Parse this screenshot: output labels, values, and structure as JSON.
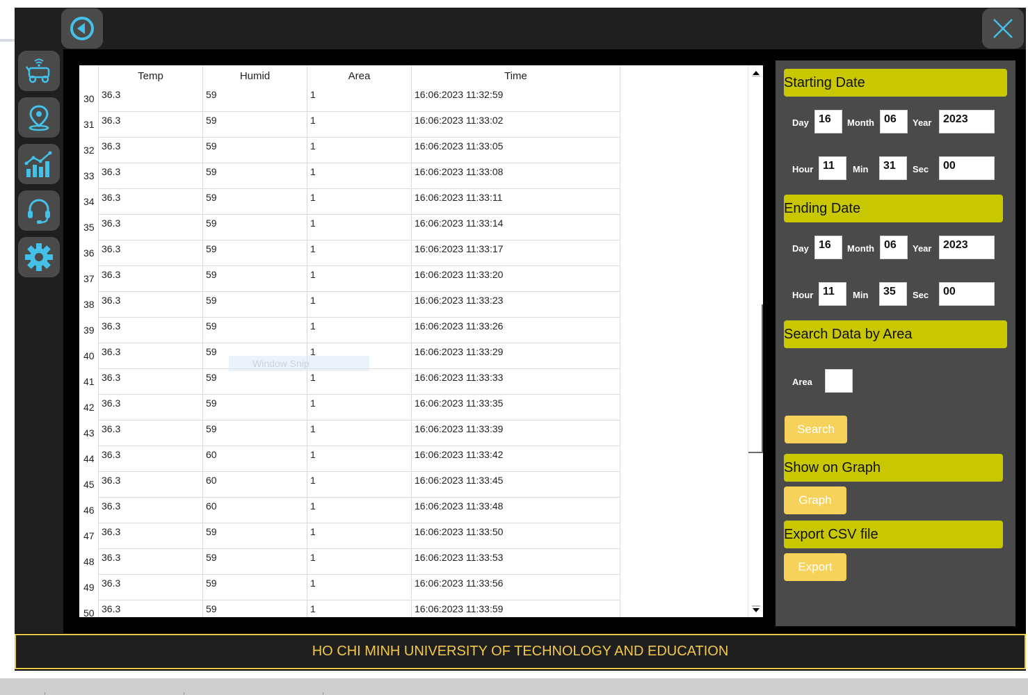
{
  "icons": {
    "back": "back-arrow-icon",
    "close": "close-x-icon",
    "sidebar": [
      "robot-car-icon",
      "location-pin-icon",
      "bar-chart-icon",
      "headset-icon",
      "gear-icon"
    ],
    "accent_color": "#44c1e8"
  },
  "table": {
    "headers": [
      "Temp",
      "Humid",
      "Area",
      "Time"
    ],
    "rows": [
      {
        "n": "30",
        "temp": "36.3",
        "humid": "59",
        "area": "1",
        "time": "16:06:2023 11:32:59"
      },
      {
        "n": "31",
        "temp": "36.3",
        "humid": "59",
        "area": "1",
        "time": "16:06:2023 11:33:02"
      },
      {
        "n": "32",
        "temp": "36.3",
        "humid": "59",
        "area": "1",
        "time": "16:06:2023 11:33:05"
      },
      {
        "n": "33",
        "temp": "36.3",
        "humid": "59",
        "area": "1",
        "time": "16:06:2023 11:33:08"
      },
      {
        "n": "34",
        "temp": "36.3",
        "humid": "59",
        "area": "1",
        "time": "16:06:2023 11:33:11"
      },
      {
        "n": "35",
        "temp": "36.3",
        "humid": "59",
        "area": "1",
        "time": "16:06:2023 11:33:14"
      },
      {
        "n": "36",
        "temp": "36.3",
        "humid": "59",
        "area": "1",
        "time": "16:06:2023 11:33:17"
      },
      {
        "n": "37",
        "temp": "36.3",
        "humid": "59",
        "area": "1",
        "time": "16:06:2023 11:33:20"
      },
      {
        "n": "38",
        "temp": "36.3",
        "humid": "59",
        "area": "1",
        "time": "16:06:2023 11:33:23"
      },
      {
        "n": "39",
        "temp": "36.3",
        "humid": "59",
        "area": "1",
        "time": "16:06:2023 11:33:26"
      },
      {
        "n": "40",
        "temp": "36.3",
        "humid": "59",
        "area": "1",
        "time": "16:06:2023 11:33:29"
      },
      {
        "n": "41",
        "temp": "36.3",
        "humid": "59",
        "area": "1",
        "time": "16:06:2023 11:33:33"
      },
      {
        "n": "42",
        "temp": "36.3",
        "humid": "59",
        "area": "1",
        "time": "16:06:2023 11:33:35"
      },
      {
        "n": "43",
        "temp": "36.3",
        "humid": "59",
        "area": "1",
        "time": "16:06:2023 11:33:39"
      },
      {
        "n": "44",
        "temp": "36.3",
        "humid": "60",
        "area": "1",
        "time": "16:06:2023 11:33:42"
      },
      {
        "n": "45",
        "temp": "36.3",
        "humid": "60",
        "area": "1",
        "time": "16:06:2023 11:33:45"
      },
      {
        "n": "46",
        "temp": "36.3",
        "humid": "60",
        "area": "1",
        "time": "16:06:2023 11:33:48"
      },
      {
        "n": "47",
        "temp": "36.3",
        "humid": "59",
        "area": "1",
        "time": "16:06:2023 11:33:50"
      },
      {
        "n": "48",
        "temp": "36.3",
        "humid": "59",
        "area": "1",
        "time": "16:06:2023 11:33:53"
      },
      {
        "n": "49",
        "temp": "36.3",
        "humid": "59",
        "area": "1",
        "time": "16:06:2023 11:33:56"
      },
      {
        "n": "50",
        "temp": "36.3",
        "humid": "59",
        "area": "1",
        "time": "16:06:2023 11:33:59"
      }
    ]
  },
  "overlay": {
    "snip_text": "Window Snip"
  },
  "panel": {
    "starting_title": "Starting Date",
    "ending_title": "Ending Date",
    "labels": {
      "day": "Day",
      "month": "Month",
      "year": "Year",
      "hour": "Hour",
      "min": "Min",
      "sec": "Sec",
      "area": "Area"
    },
    "start": {
      "day": "16",
      "month": "06",
      "year": "2023",
      "hour": "11",
      "min": "31",
      "sec": "00"
    },
    "end": {
      "day": "16",
      "month": "06",
      "year": "2023",
      "hour": "11",
      "min": "35",
      "sec": "00"
    },
    "area_title": "Search Data by Area",
    "area_value": "",
    "search_label": "Search",
    "graph_title": "Show on Graph",
    "graph_label": "Graph",
    "export_title": "Export CSV file",
    "export_label": "Export"
  },
  "footer": {
    "text": "HO CHI MINH UNIVERSITY OF TECHNOLOGY AND EDUCATION"
  }
}
